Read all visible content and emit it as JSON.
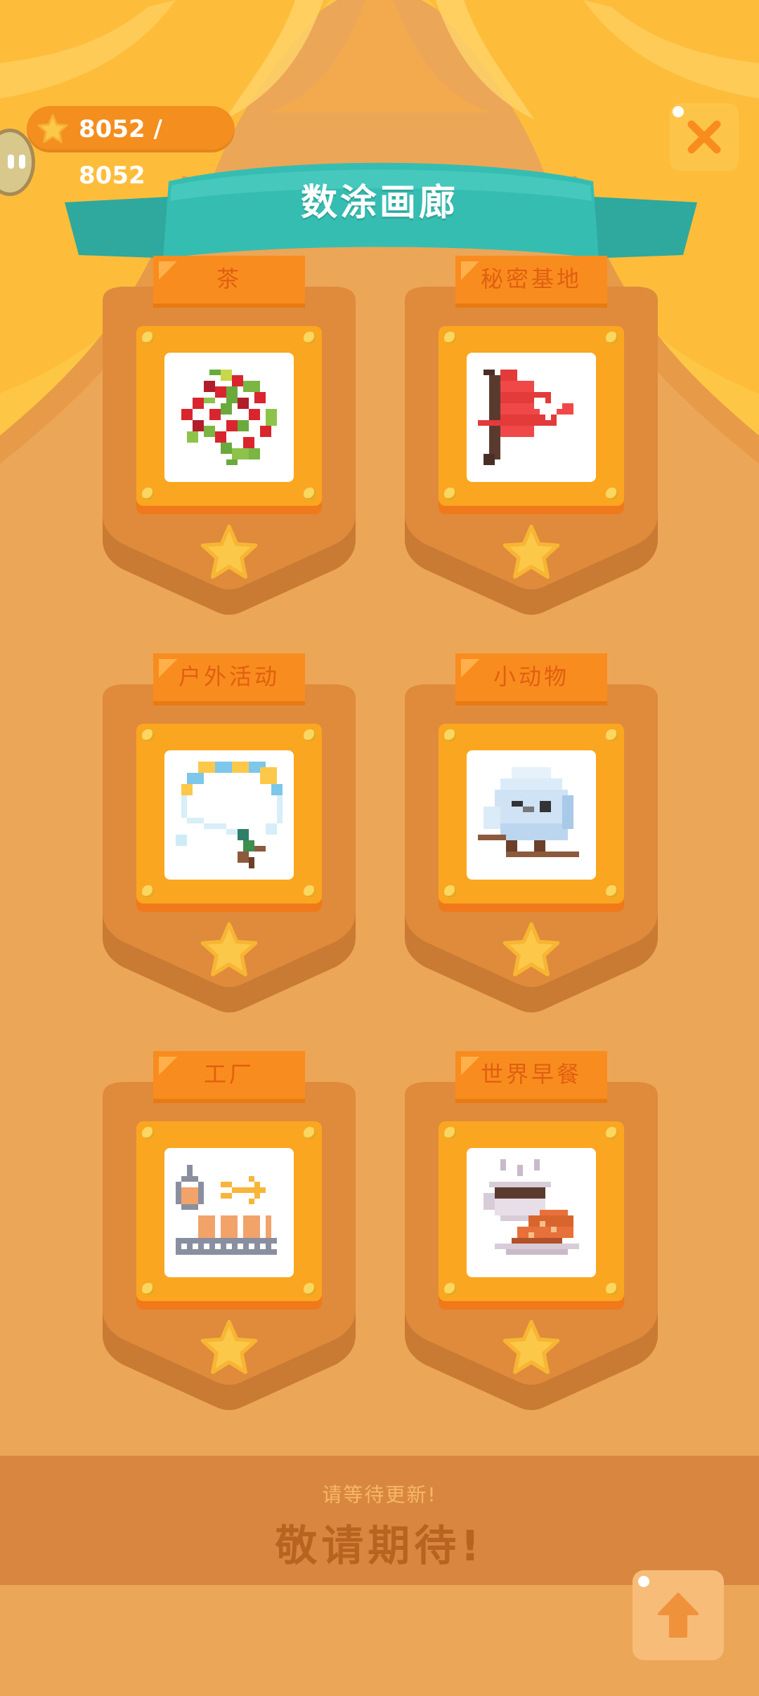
{
  "header": {
    "coins_text": "8052 / 8052",
    "title": "数涂画廊",
    "coin_icon": "star-icon",
    "close_icon": "close-icon"
  },
  "gallery": [
    {
      "label": "茶",
      "art": "berries"
    },
    {
      "label": "秘密基地",
      "art": "flag"
    },
    {
      "label": "户外活动",
      "art": "paraglider"
    },
    {
      "label": "小动物",
      "art": "bird"
    },
    {
      "label": "工厂",
      "art": "factory"
    },
    {
      "label": "世界早餐",
      "art": "breakfast"
    }
  ],
  "footer": {
    "subtitle": "请等待更新!",
    "main": "敬请期待!",
    "scroll_top_icon": "arrow-up-icon"
  },
  "colors": {
    "background": "#ECA657",
    "accent_orange": "#F98C1E",
    "banner_teal": "#34B8AE",
    "star_yellow": "#FCC84A"
  }
}
